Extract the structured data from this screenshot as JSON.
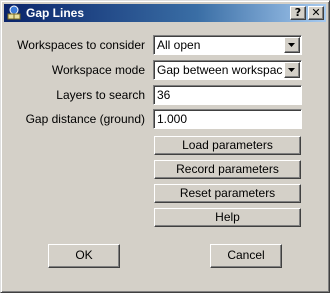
{
  "window": {
    "title": "Gap Lines",
    "help_caption": "?",
    "close_caption": "✕"
  },
  "form": {
    "workspaces": {
      "label": "Workspaces to consider",
      "value": "All open"
    },
    "mode": {
      "label": "Workspace mode",
      "value": "Gap between workspaces"
    },
    "layers": {
      "label": "Layers to search",
      "value": "36"
    },
    "gap": {
      "label": "Gap distance (ground)",
      "value": "1.000"
    }
  },
  "buttons": {
    "load": "Load parameters",
    "record": "Record parameters",
    "reset": "Reset parameters",
    "help": "Help",
    "ok": "OK",
    "cancel": "Cancel"
  },
  "icons": {
    "app": "gap-lines-app-icon",
    "dropdown": "chevron-down-icon"
  }
}
